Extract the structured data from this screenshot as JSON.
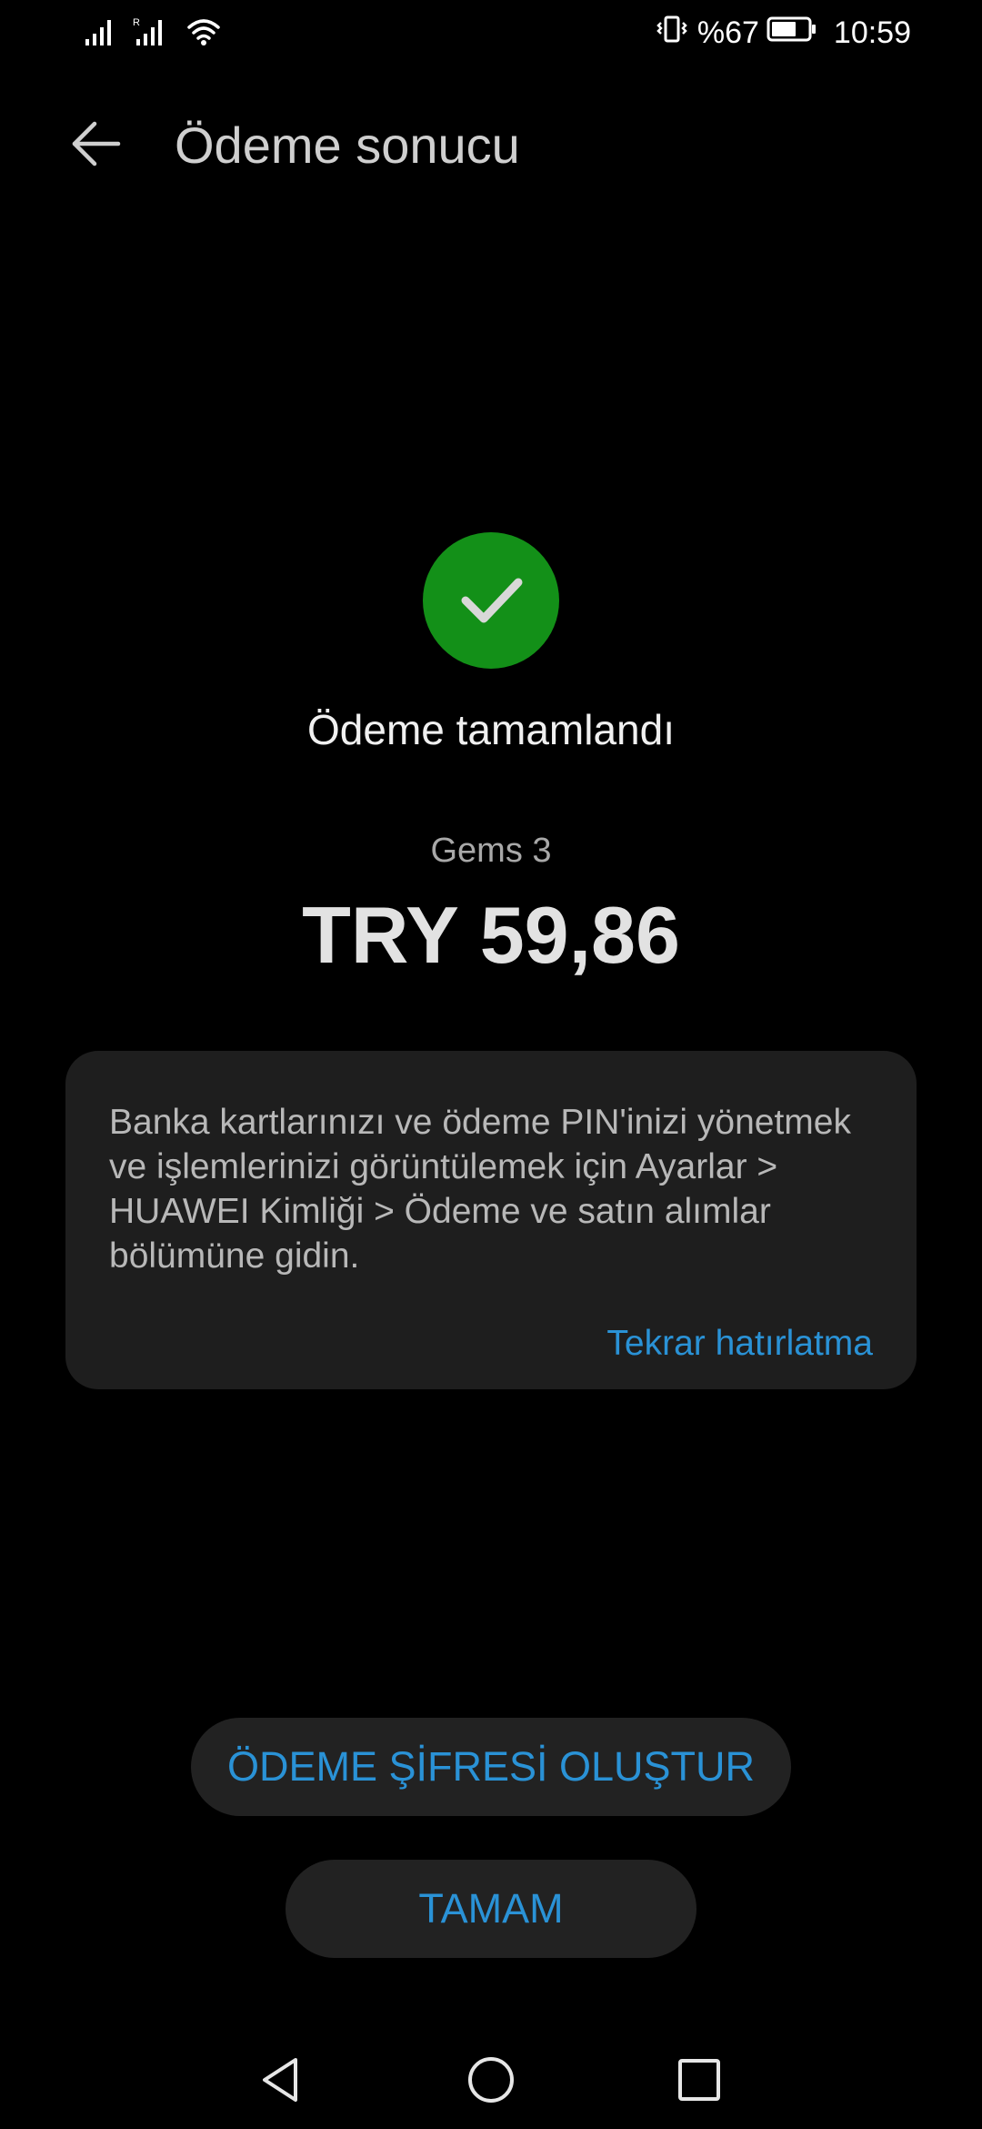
{
  "status_bar": {
    "battery_percent": "%67",
    "time": "10:59",
    "icons": [
      "signal-icon",
      "signal-icon",
      "wifi-icon",
      "vibrate-icon",
      "battery-icon"
    ]
  },
  "header": {
    "title": "Ödeme sonucu",
    "back_icon": "arrow-left-icon"
  },
  "result": {
    "icon": "check-circle-icon",
    "icon_color": "#139018",
    "status_text": "Ödeme tamamlandı",
    "product": "Gems 3",
    "amount": "TRY 59,86"
  },
  "info_card": {
    "text": "Banka kartlarınızı ve ödeme PIN'inizi yönetmek ve işlemlerinizi görüntülemek için Ayarlar > HUAWEI Kimliği > Ödeme ve satın alımlar bölümüne gidin.",
    "link_label": "Tekrar hatırlatma"
  },
  "actions": {
    "create_password_label": "ÖDEME ŞİFRESİ OLUŞTUR",
    "ok_label": "TAMAM"
  },
  "nav_bar": {
    "icons": [
      "nav-back-icon",
      "nav-home-icon",
      "nav-recents-icon"
    ]
  },
  "colors": {
    "background": "#000000",
    "accent": "#2a92d6",
    "card": "#1e1e1e",
    "button": "#222222"
  }
}
